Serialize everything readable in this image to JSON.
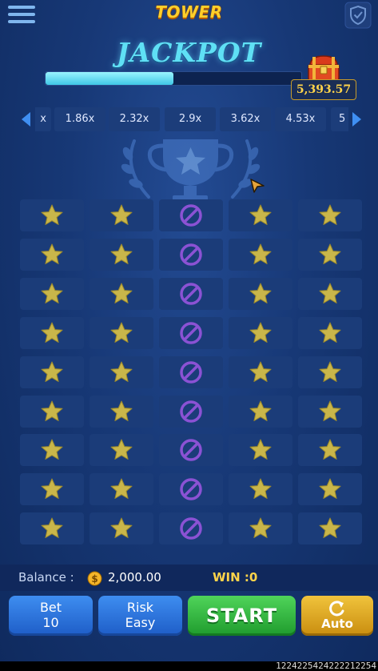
{
  "header": {
    "title": "TOWER",
    "menu_icon": "hamburger-menu-icon",
    "fairness_icon": "shield-check-icon"
  },
  "jackpot": {
    "label": "JACKPOT",
    "amount": "5,393.57",
    "progress_fraction": 0.5,
    "chest_icon": "treasure-chest-icon"
  },
  "multipliers": {
    "partial_left": "x",
    "items": [
      "1.86x",
      "2.32x",
      "2.9x",
      "3.62x",
      "4.53x"
    ],
    "partial_right": "5",
    "prev_icon": "arrow-left-icon",
    "next_icon": "arrow-right-icon"
  },
  "board": {
    "rows": 9,
    "columns": 5,
    "pattern_row": [
      "star",
      "star",
      "blocked",
      "star",
      "star"
    ],
    "star_icon": "star-icon",
    "blocked_icon": "blocked-icon"
  },
  "status": {
    "balance_label": "Balance :",
    "balance_value": "2,000.00",
    "win_label": "WIN :0"
  },
  "controls": {
    "bet_label": "Bet",
    "bet_value": "10",
    "risk_label": "Risk",
    "risk_value": "Easy",
    "start_label": "START",
    "auto_label": "Auto"
  },
  "footer": {
    "text": "1224225424222212254                                 "
  },
  "colors": {
    "background": "#173876",
    "cell": "#1b3c79",
    "star": "#c9b64a",
    "blocked": "#8b52d4",
    "accent_gold": "#ffd44a",
    "jackpot_cyan": "#5fe0f5"
  }
}
